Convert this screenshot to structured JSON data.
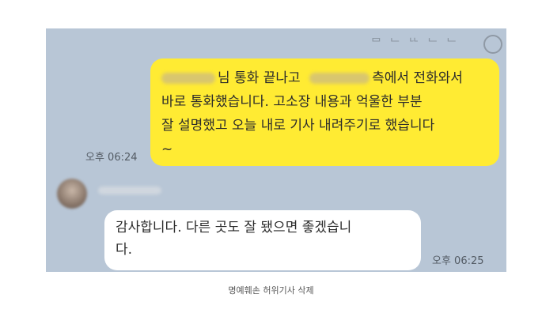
{
  "chat": {
    "top_cut_text": "ᆷ ᆫ ᆫᆫ ᆫ ᆫ",
    "outgoing": {
      "line1_a": "님 통화 끝나고",
      "line1_b": "측에서 전화와서",
      "line2": "바로 통화했습니다. 고소장 내용과 억울한 부분",
      "line3": "잘 설명했고 오늘 내로 기사 내려주기로 했습니다",
      "line4": "~",
      "time": "오후 06:24"
    },
    "incoming": {
      "line1": "감사합니다. 다른 곳도 잘 됐으면 좋겠습니",
      "line2": "다.",
      "time": "오후 06:25"
    }
  },
  "caption": "명예훼손 허위기사 삭제"
}
